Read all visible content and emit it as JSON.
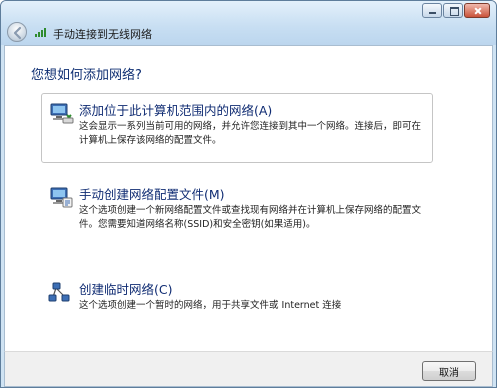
{
  "window": {
    "title": "手动连接到无线网络",
    "controls": {
      "minimize_icon": "minimize-icon",
      "maximize_icon": "maximize-icon",
      "close_icon": "close-icon"
    }
  },
  "content": {
    "heading": "您想如何添加网络?",
    "options": [
      {
        "icon": "wireless-network-icon",
        "title": "添加位于此计算机范围内的网络(A)",
        "description": "这会显示一系列当前可用的网络，并允许您连接到其中一个网络。连接后，即可在计算机上保存该网络的配置文件。",
        "highlighted": true
      },
      {
        "icon": "wireless-profile-icon",
        "title": "手动创建网络配置文件(M)",
        "description": "这个选项创建一个新网络配置文件或查找现有网络并在计算机上保存网络的配置文件。您需要知道网络名称(SSID)和安全密钥(如果适用)。",
        "highlighted": false
      },
      {
        "icon": "adhoc-network-icon",
        "title": "创建临时网络(C)",
        "description": "这个选项创建一个暂时的网络，用于共享文件或 Internet 连接",
        "highlighted": false
      }
    ]
  },
  "footer": {
    "cancel_label": "取消"
  }
}
